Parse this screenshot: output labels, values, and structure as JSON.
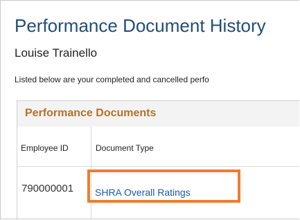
{
  "page": {
    "title": "Performance Document History",
    "employee_name": "Louise Trainello",
    "intro_text": "Listed below are your completed and cancelled perfo"
  },
  "documents_grid": {
    "title": "Performance Documents",
    "columns": [
      "Employee ID",
      "Document Type"
    ],
    "rows": [
      {
        "employee_id": "790000001",
        "document_type": "SHRA Overall Ratings"
      }
    ]
  },
  "annotation": {
    "highlight_color": "#ed7d31"
  },
  "colors": {
    "title": "#1f4e79",
    "grid_title": "#b8702a",
    "link": "#1a5aa8"
  }
}
